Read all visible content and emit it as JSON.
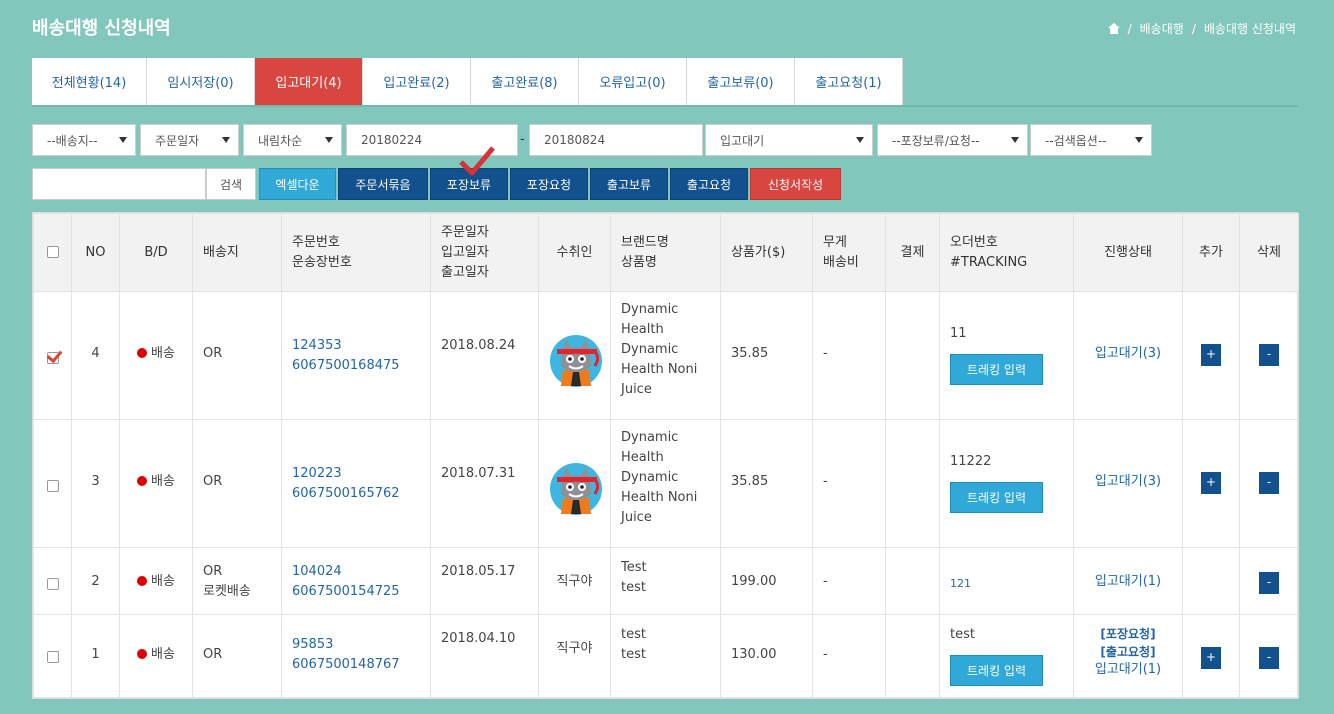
{
  "page": {
    "title": "배송대행 신청내역"
  },
  "breadcrumb": [
    "배송대행",
    "배송대행 신청내역"
  ],
  "tabs": [
    {
      "label": "전체현황(14)",
      "w": 115
    },
    {
      "label": "임시저장(0)",
      "w": 108
    },
    {
      "label": "입고대기(4)",
      "w": 108,
      "active": true
    },
    {
      "label": "입고완료(2)",
      "w": 108
    },
    {
      "label": "출고완료(8)",
      "w": 108
    },
    {
      "label": "오류입고(0)",
      "w": 108
    },
    {
      "label": "출고보류(0)",
      "w": 108
    },
    {
      "label": "출고요청(1)",
      "w": 108
    }
  ],
  "filters": {
    "ship_to": "--배송지--",
    "order_date": "주문일자",
    "sort": "내림차순",
    "date_from": "20180224",
    "date_to": "20180824",
    "status": "입고대기",
    "packing": "--포장보류/요청--",
    "search_option": "--검색옵션--"
  },
  "actions": {
    "search": "검색",
    "excel": "엑셀다운",
    "merge": "주문서묶음",
    "hold": "포장보류",
    "pack_request": "포장요청",
    "ship_hold": "출고보류",
    "ship_request": "출고요청",
    "write_application": "신청서작성"
  },
  "table": {
    "headers": {
      "no": "NO",
      "bd": "B/D",
      "dest": "배송지",
      "order_no_1": "주문번호",
      "order_no_2": "운송장번호",
      "dates_1": "주문일자",
      "dates_2": "입고일자",
      "dates_3": "출고일자",
      "recipient": "수취인",
      "brand_1": "브랜드명",
      "brand_2": "상품명",
      "price": "상품가($)",
      "weight_1": "무게",
      "weight_2": "배송비",
      "payment": "결제",
      "order_tracking_1": "오더번호",
      "order_tracking_2": "#TRACKING",
      "status": "진행상태",
      "add": "추가",
      "delete": "삭제"
    },
    "rows": [
      {
        "no": "4",
        "bd": "배송",
        "dest": [
          "OR"
        ],
        "order_no": "124353",
        "tracking_no": "6067500168475",
        "date": "2018.08.24",
        "recipient": "",
        "avatar": true,
        "brand": [
          "Dynamic",
          "Health",
          "Dynamic",
          "Health Noni",
          "Juice"
        ],
        "price": "35.85",
        "weight": "-",
        "order_ref": "11",
        "tracking_btn": "트레킹 입력",
        "status": [
          "입고대기(3)"
        ],
        "add": "+",
        "del": "-",
        "checked": true
      },
      {
        "no": "3",
        "bd": "배송",
        "dest": [
          "OR"
        ],
        "order_no": "120223",
        "tracking_no": "6067500165762",
        "date": "2018.07.31",
        "recipient": "",
        "avatar": true,
        "brand": [
          "Dynamic",
          "Health",
          "Dynamic",
          "Health Noni",
          "Juice"
        ],
        "price": "35.85",
        "weight": "-",
        "order_ref": "11222",
        "tracking_btn": "트레킹 입력",
        "status": [
          "입고대기(3)"
        ],
        "add": "+",
        "del": "-",
        "checked": false
      },
      {
        "no": "2",
        "bd": "배송",
        "dest": [
          "OR",
          "로켓배송"
        ],
        "order_no": "104024",
        "tracking_no": "6067500154725",
        "date": "2018.05.17",
        "recipient": "직구야",
        "avatar": false,
        "brand": [
          "Test",
          "test"
        ],
        "price": "199.00",
        "weight": "-",
        "order_ref": "121",
        "tracking_btn": "",
        "status": [
          "입고대기(1)"
        ],
        "add": "",
        "del": "-",
        "checked": false
      },
      {
        "no": "1",
        "bd": "배송",
        "dest": [
          "OR"
        ],
        "order_no": "95853",
        "tracking_no": "6067500148767",
        "date": "2018.04.10",
        "recipient": "직구야",
        "avatar": false,
        "brand": [
          "test",
          "test"
        ],
        "price": "130.00",
        "weight": "-",
        "order_ref": "test",
        "tracking_btn": "트레킹 입력",
        "status": [
          "[포장요청]",
          "[출고요청]",
          "입고대기(1)"
        ],
        "add": "+",
        "del": "-",
        "checked": false
      }
    ]
  },
  "colors": {
    "bg": "#82c7bc",
    "accent_red": "#d9453f",
    "navy": "#13508e",
    "cyan": "#31a9d8",
    "link": "#2366a8"
  }
}
